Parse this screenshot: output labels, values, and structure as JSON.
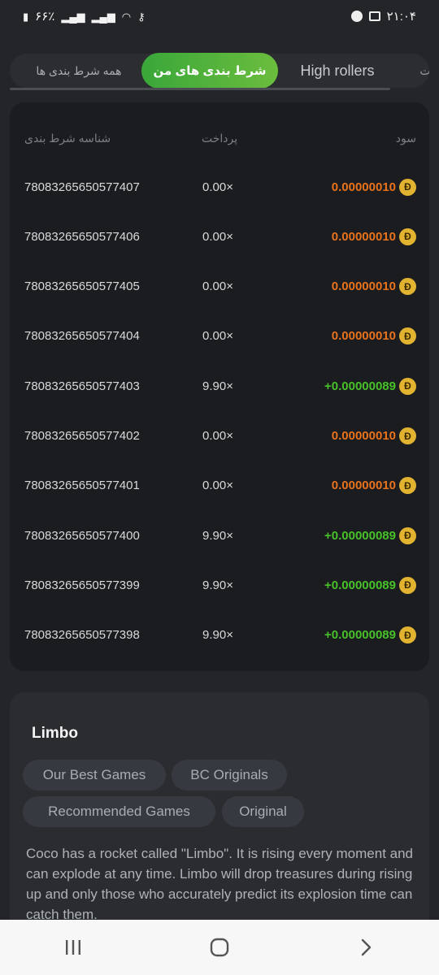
{
  "status_bar": {
    "time": "۲۱:۰۴",
    "battery": "۶۶٪"
  },
  "tabs": {
    "all_bets": "همه شرط بندی ها",
    "my_bets": "شرط بندی های من",
    "high_rollers": "High rollers",
    "overflow": "ت"
  },
  "bets_table": {
    "headers": {
      "bet_id": "شناسه شرط بندی",
      "payout": "پرداخت",
      "profit": "سود"
    },
    "coin_symbol": "Đ",
    "rows": [
      {
        "id": "78083265650577407",
        "payout": "0.00×",
        "profit": "0.00000010",
        "sign": "neg"
      },
      {
        "id": "78083265650577406",
        "payout": "0.00×",
        "profit": "0.00000010",
        "sign": "neg"
      },
      {
        "id": "78083265650577405",
        "payout": "0.00×",
        "profit": "0.00000010",
        "sign": "neg"
      },
      {
        "id": "78083265650577404",
        "payout": "0.00×",
        "profit": "0.00000010",
        "sign": "neg"
      },
      {
        "id": "78083265650577403",
        "payout": "9.90×",
        "profit": "+0.00000089",
        "sign": "pos"
      },
      {
        "id": "78083265650577402",
        "payout": "0.00×",
        "profit": "0.00000010",
        "sign": "neg"
      },
      {
        "id": "78083265650577401",
        "payout": "0.00×",
        "profit": "0.00000010",
        "sign": "neg"
      },
      {
        "id": "78083265650577400",
        "payout": "9.90×",
        "profit": "+0.00000089",
        "sign": "pos"
      },
      {
        "id": "78083265650577399",
        "payout": "9.90×",
        "profit": "+0.00000089",
        "sign": "pos"
      },
      {
        "id": "78083265650577398",
        "payout": "9.90×",
        "profit": "+0.00000089",
        "sign": "pos"
      }
    ]
  },
  "game": {
    "title": "Limbo",
    "tags": [
      "Our Best Games",
      "BC Originals",
      "Recommended Games",
      "Original"
    ],
    "description": "Coco has a rocket called \"Limbo\". It is rising every moment and can explode at any time. Limbo will drop treasures during rising up and only those who accurately predict its explosion time can catch them."
  },
  "colors": {
    "accent_green": "#48c229",
    "loss_orange": "#e8731c",
    "coin_gold": "#e2b331"
  }
}
